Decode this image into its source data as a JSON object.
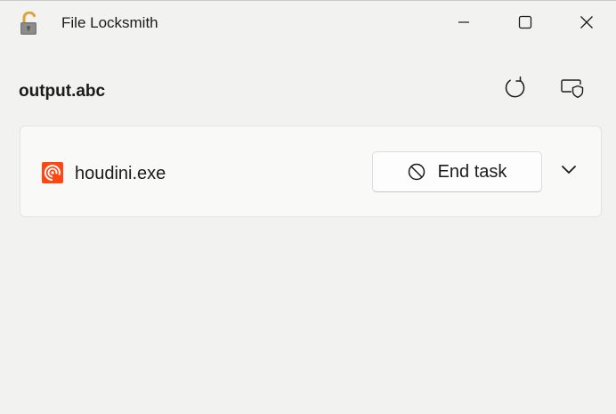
{
  "window": {
    "title": "File Locksmith",
    "app_icon": "padlock-unlocked-icon",
    "controls": {
      "minimize_icon": "minimize-icon",
      "maximize_icon": "maximize-icon",
      "close_icon": "close-icon"
    }
  },
  "header": {
    "file_name": "output.abc",
    "refresh_icon": "refresh-icon",
    "admin_icon": "restart-as-admin-shield-icon"
  },
  "processes": [
    {
      "name": "houdini.exe",
      "icon": "houdini-icon",
      "end_task_label": "End task",
      "end_task_icon": "block-icon",
      "expand_icon": "chevron-down-icon"
    }
  ],
  "colors": {
    "background": "#f2f2f0",
    "card": "#f9f9f8",
    "houdini_orange": "#ff4713",
    "lock_body": "#7a7a7a",
    "lock_shackle": "#e0a236"
  }
}
